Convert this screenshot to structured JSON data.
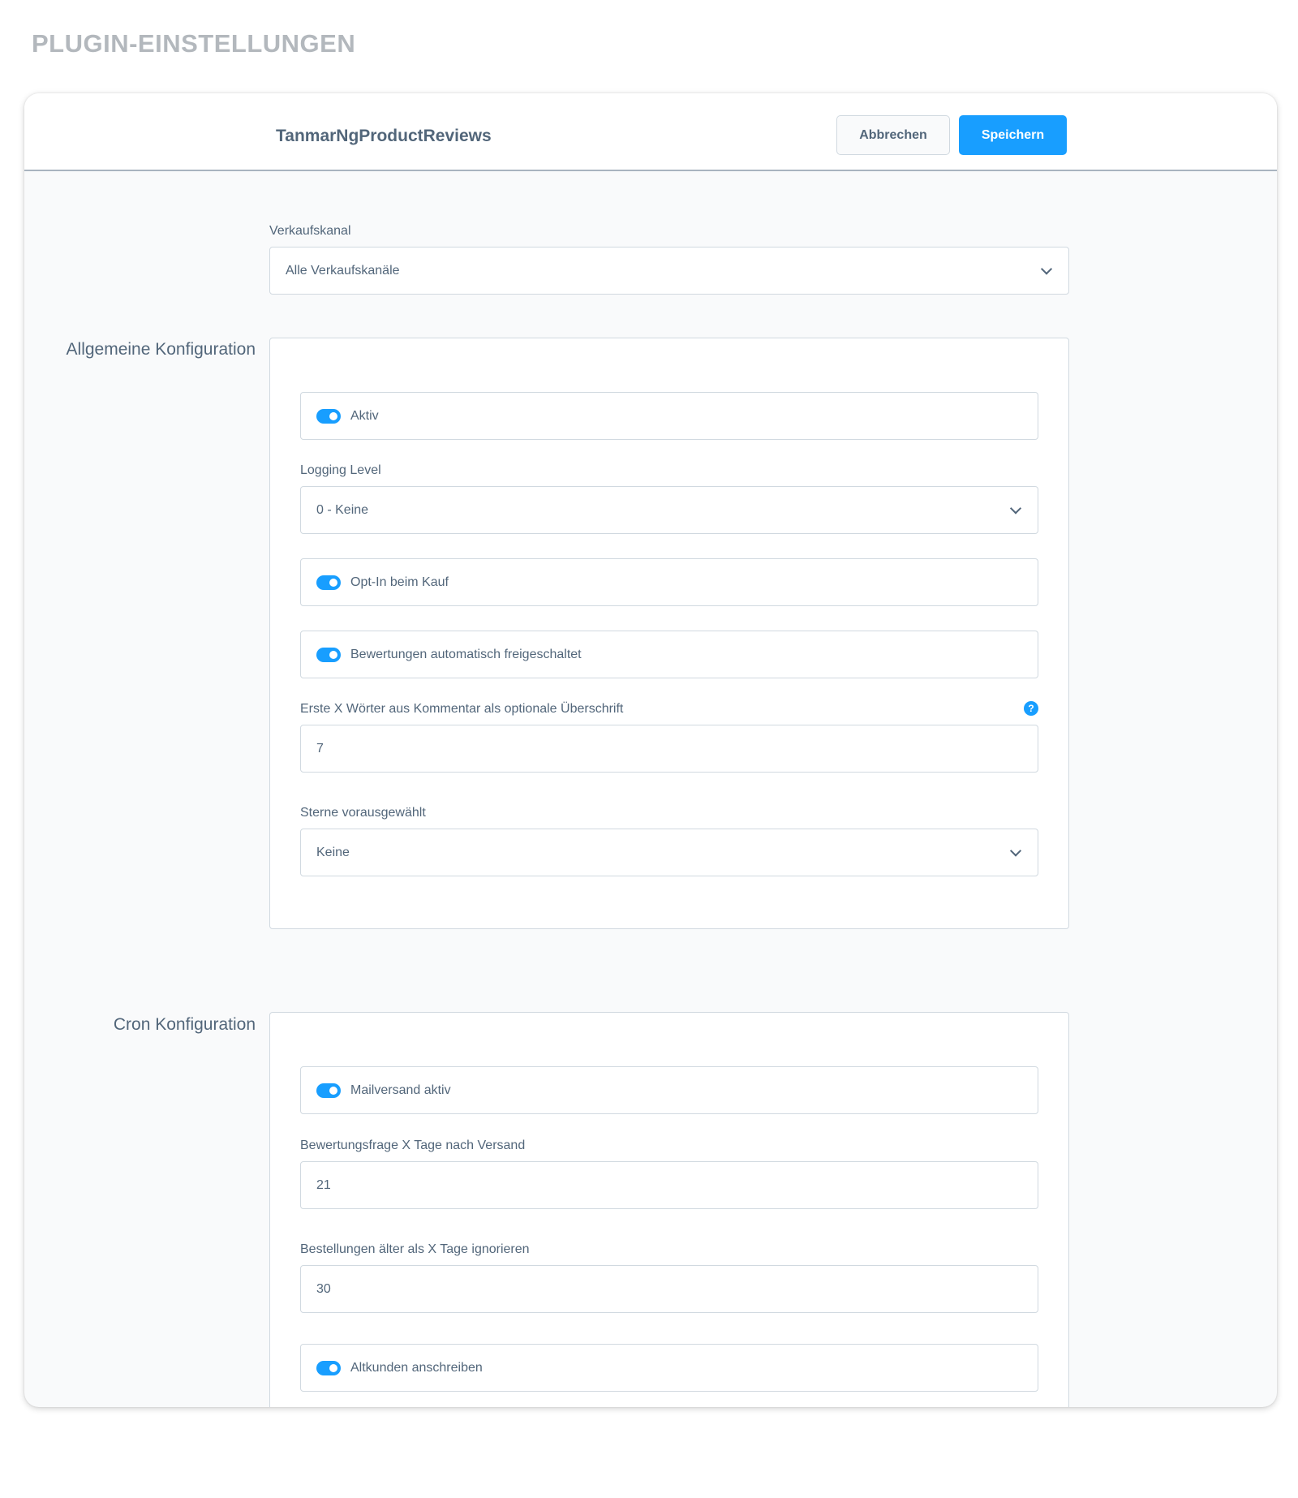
{
  "page": {
    "heading": "PLUGIN-EINSTELLUNGEN"
  },
  "header": {
    "plugin_name": "TanmarNgProductReviews",
    "cancel_label": "Abbrechen",
    "save_label": "Speichern"
  },
  "sales_channel": {
    "label": "Verkaufskanal",
    "value": "Alle Verkaufskanäle"
  },
  "general": {
    "title": "Allgemeine Konfiguration",
    "active": {
      "label": "Aktiv",
      "on": true
    },
    "logging": {
      "label": "Logging Level",
      "value": "0 - Keine"
    },
    "optin": {
      "label": "Opt-In beim Kauf",
      "on": true
    },
    "auto_approve": {
      "label": "Bewertungen automatisch freigeschaltet",
      "on": true
    },
    "first_words": {
      "label": "Erste X Wörter aus Kommentar als optionale Überschrift",
      "value": "7",
      "help_icon": "question-icon",
      "help_glyph": "?"
    },
    "stars": {
      "label": "Sterne vorausgewählt",
      "value": "Keine"
    }
  },
  "cron": {
    "title": "Cron Konfiguration",
    "mail_active": {
      "label": "Mailversand aktiv",
      "on": true
    },
    "days_after_shipping": {
      "label": "Bewertungsfrage X Tage nach Versand",
      "value": "21"
    },
    "ignore_older": {
      "label": "Bestellungen älter als X Tage ignorieren",
      "value": "30"
    },
    "old_customers": {
      "label": "Altkunden anschreiben",
      "on": true
    }
  },
  "colors": {
    "accent": "#189eff",
    "text": "#52667a",
    "heading": "#b3b8bd"
  }
}
